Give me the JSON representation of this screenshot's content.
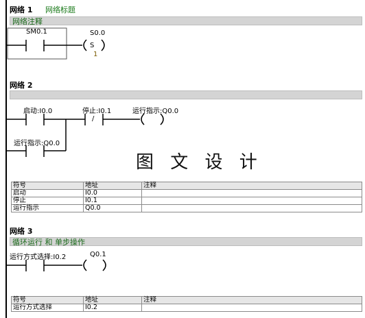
{
  "network1": {
    "title": "网络 1",
    "subtitle": "网络标题",
    "comment": "网络注释",
    "contact_label": "SM0.1",
    "coil_label": "S0.0",
    "coil_symbol": "S",
    "coil_count": "1"
  },
  "network2": {
    "title": "网络 2",
    "comment": "",
    "start_label": "启动:I0.0",
    "stop_label": "停止:I0.1",
    "run_label": "运行指示:Q0.0",
    "hold_label": "运行指示:Q0.0",
    "neg_symbol": "/"
  },
  "watermark": "图 文 设 计",
  "table1": {
    "headers": [
      "符号",
      "地址",
      "注释"
    ],
    "rows": [
      [
        "启动",
        "I0.0",
        ""
      ],
      [
        "停止",
        "I0.1",
        ""
      ],
      [
        "运行指示",
        "Q0.0",
        ""
      ]
    ]
  },
  "network3": {
    "title": "网络 3",
    "comment": "循环运行 和 单步操作",
    "contact_label": "运行方式选择:I0.2",
    "coil_label": "Q0.1"
  },
  "table2": {
    "headers": [
      "符号",
      "地址",
      "注释"
    ],
    "rows": [
      [
        "运行方式选择",
        "I0.2",
        ""
      ]
    ]
  }
}
